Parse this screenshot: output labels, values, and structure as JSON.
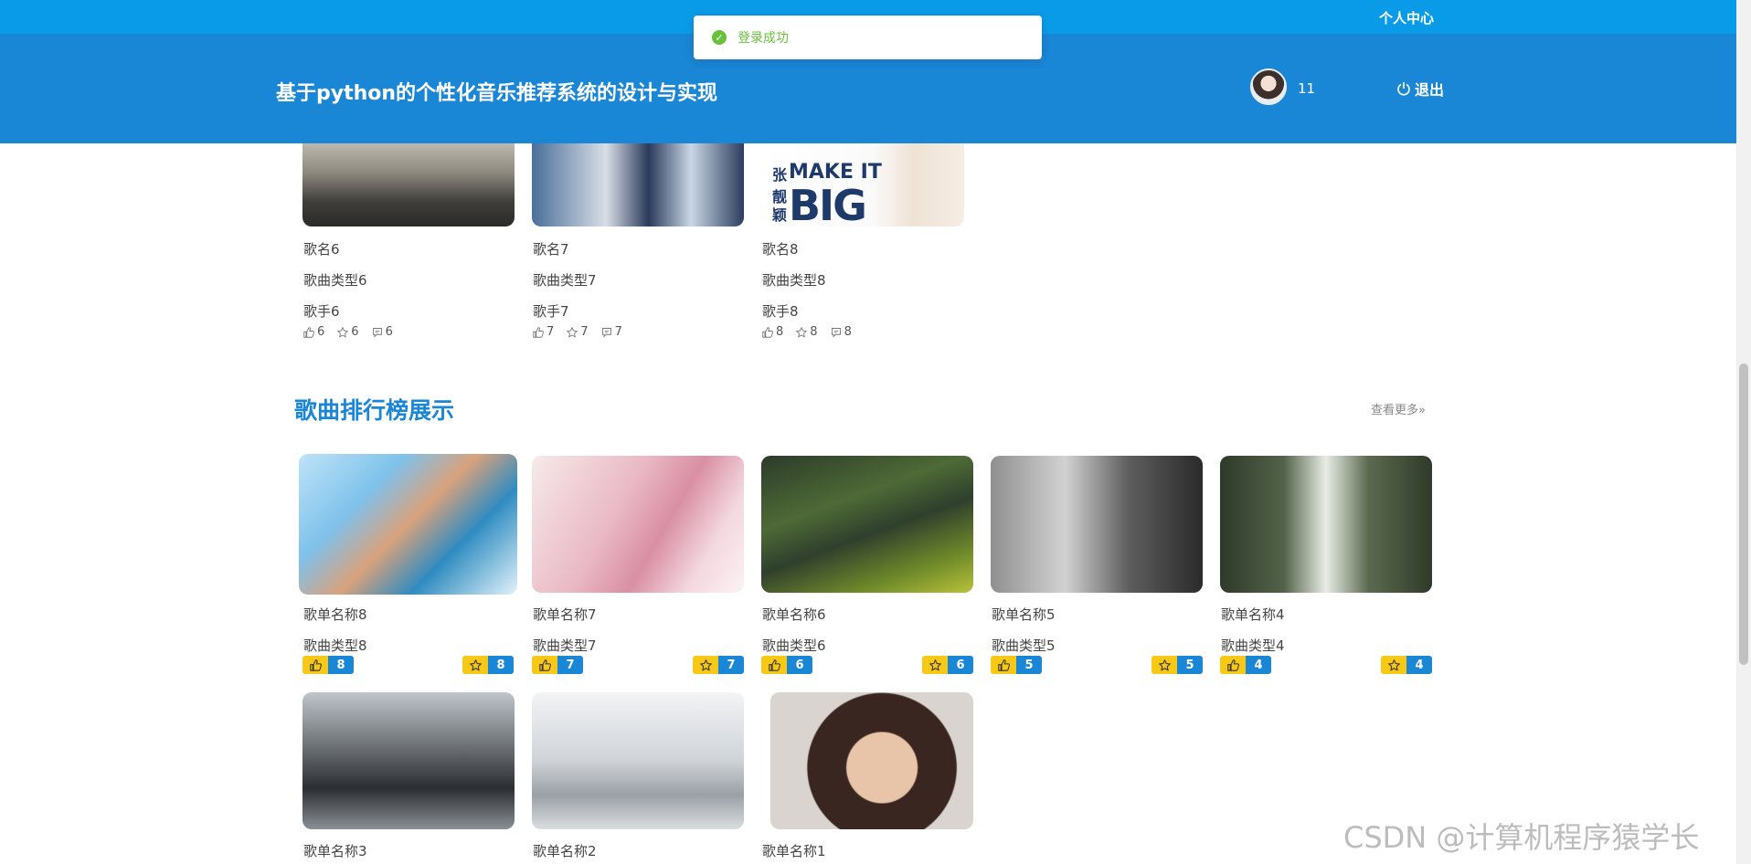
{
  "header": {
    "personal_center": "个人中心",
    "site_title": "基于python的个性化音乐推荐系统的设计与实现",
    "username": "11",
    "logout": "退出"
  },
  "toast": {
    "message": "登录成功"
  },
  "songs": [
    {
      "name": "歌名6",
      "type": "歌曲类型6",
      "singer": "歌手6",
      "likes": "6",
      "favorites": "6",
      "comments": "6"
    },
    {
      "name": "歌名7",
      "type": "歌曲类型7",
      "singer": "歌手7",
      "likes": "7",
      "favorites": "7",
      "comments": "7"
    },
    {
      "name": "歌名8",
      "type": "歌曲类型8",
      "singer": "歌手8",
      "likes": "8",
      "favorites": "8",
      "comments": "8",
      "cover_text_1": "张",
      "cover_text_2": "MAKE IT",
      "cover_text_3": "靓",
      "cover_text_4": "颖",
      "cover_text_5": "BIG"
    }
  ],
  "ranking": {
    "title": "歌曲排行榜展示",
    "see_more": "查看更多»",
    "items": [
      {
        "name": "歌单名称8",
        "type": "歌曲类型8",
        "likes": "8",
        "favorites": "8"
      },
      {
        "name": "歌单名称7",
        "type": "歌曲类型7",
        "likes": "7",
        "favorites": "7"
      },
      {
        "name": "歌单名称6",
        "type": "歌曲类型6",
        "likes": "6",
        "favorites": "6"
      },
      {
        "name": "歌单名称5",
        "type": "歌曲类型5",
        "likes": "5",
        "favorites": "5"
      },
      {
        "name": "歌单名称4",
        "type": "歌曲类型4",
        "likes": "4",
        "favorites": "4"
      },
      {
        "name": "歌单名称3"
      },
      {
        "name": "歌单名称2"
      },
      {
        "name": "歌单名称1"
      }
    ]
  },
  "watermark": "CSDN @计算机程序猿学长",
  "colors": {
    "primary": "#1a86d6",
    "topbar": "#0a9be8",
    "badge_yellow": "#f7c815",
    "success": "#67c23a"
  },
  "icons": {
    "like": "thumb-up-icon",
    "favorite": "star-icon",
    "comment": "comment-icon",
    "logout": "power-icon",
    "success": "check-circle-icon"
  }
}
